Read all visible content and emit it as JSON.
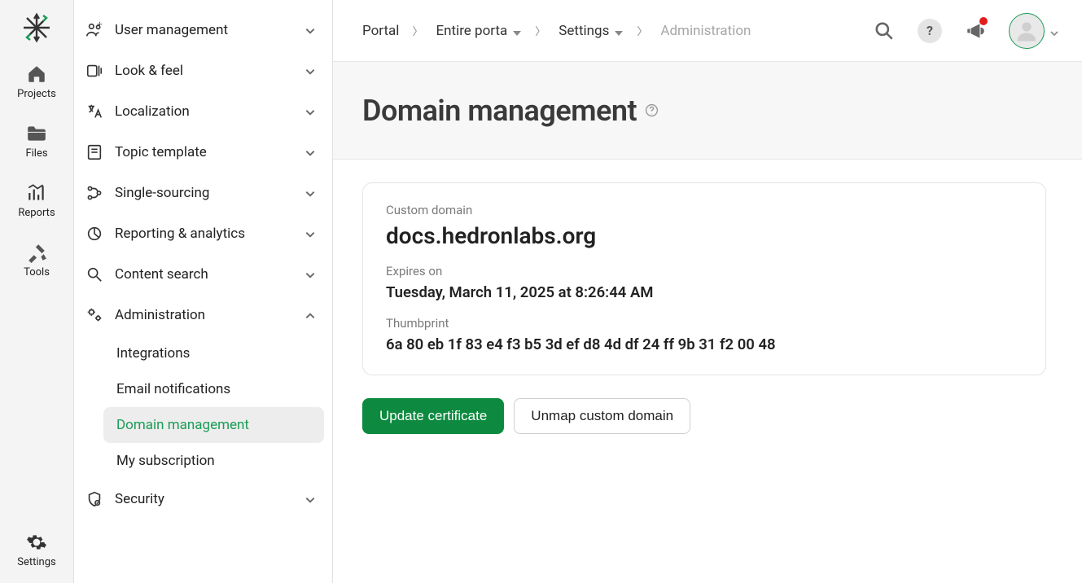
{
  "iconbar": {
    "items": [
      {
        "label": "Projects"
      },
      {
        "label": "Files"
      },
      {
        "label": "Reports"
      },
      {
        "label": "Tools"
      }
    ],
    "bottom": {
      "label": "Settings"
    }
  },
  "panel": {
    "sections": [
      {
        "label": "User management",
        "expanded": false
      },
      {
        "label": "Look & feel",
        "expanded": false
      },
      {
        "label": "Localization",
        "expanded": false
      },
      {
        "label": "Topic template",
        "expanded": false
      },
      {
        "label": "Single-sourcing",
        "expanded": false
      },
      {
        "label": "Reporting & analytics",
        "expanded": false
      },
      {
        "label": "Content search",
        "expanded": false
      },
      {
        "label": "Administration",
        "expanded": true,
        "children": [
          {
            "label": "Integrations",
            "active": false
          },
          {
            "label": "Email notifications",
            "active": false
          },
          {
            "label": "Domain management",
            "active": true
          },
          {
            "label": "My subscription",
            "active": false
          }
        ]
      },
      {
        "label": "Security",
        "expanded": false
      }
    ]
  },
  "breadcrumb": {
    "items": [
      {
        "label": "Portal",
        "dropdown": false
      },
      {
        "label": "Entire porta",
        "dropdown": true
      },
      {
        "label": "Settings",
        "dropdown": true
      },
      {
        "label": "Administration",
        "dropdown": false,
        "current": true
      }
    ]
  },
  "topbar": {
    "help": "?"
  },
  "page": {
    "title": "Domain management",
    "card": {
      "domain_label": "Custom domain",
      "domain_value": "docs.hedronlabs.org",
      "expires_label": "Expires on",
      "expires_value": "Tuesday, March 11, 2025 at 8:26:44 AM",
      "thumb_label": "Thumbprint",
      "thumb_value": "6a 80 eb 1f 83 e4 f3 b5 3d ef d8 4d df 24 ff 9b 31 f2 00 48"
    },
    "buttons": {
      "update": "Update certificate",
      "unmap": "Unmap custom domain"
    }
  }
}
